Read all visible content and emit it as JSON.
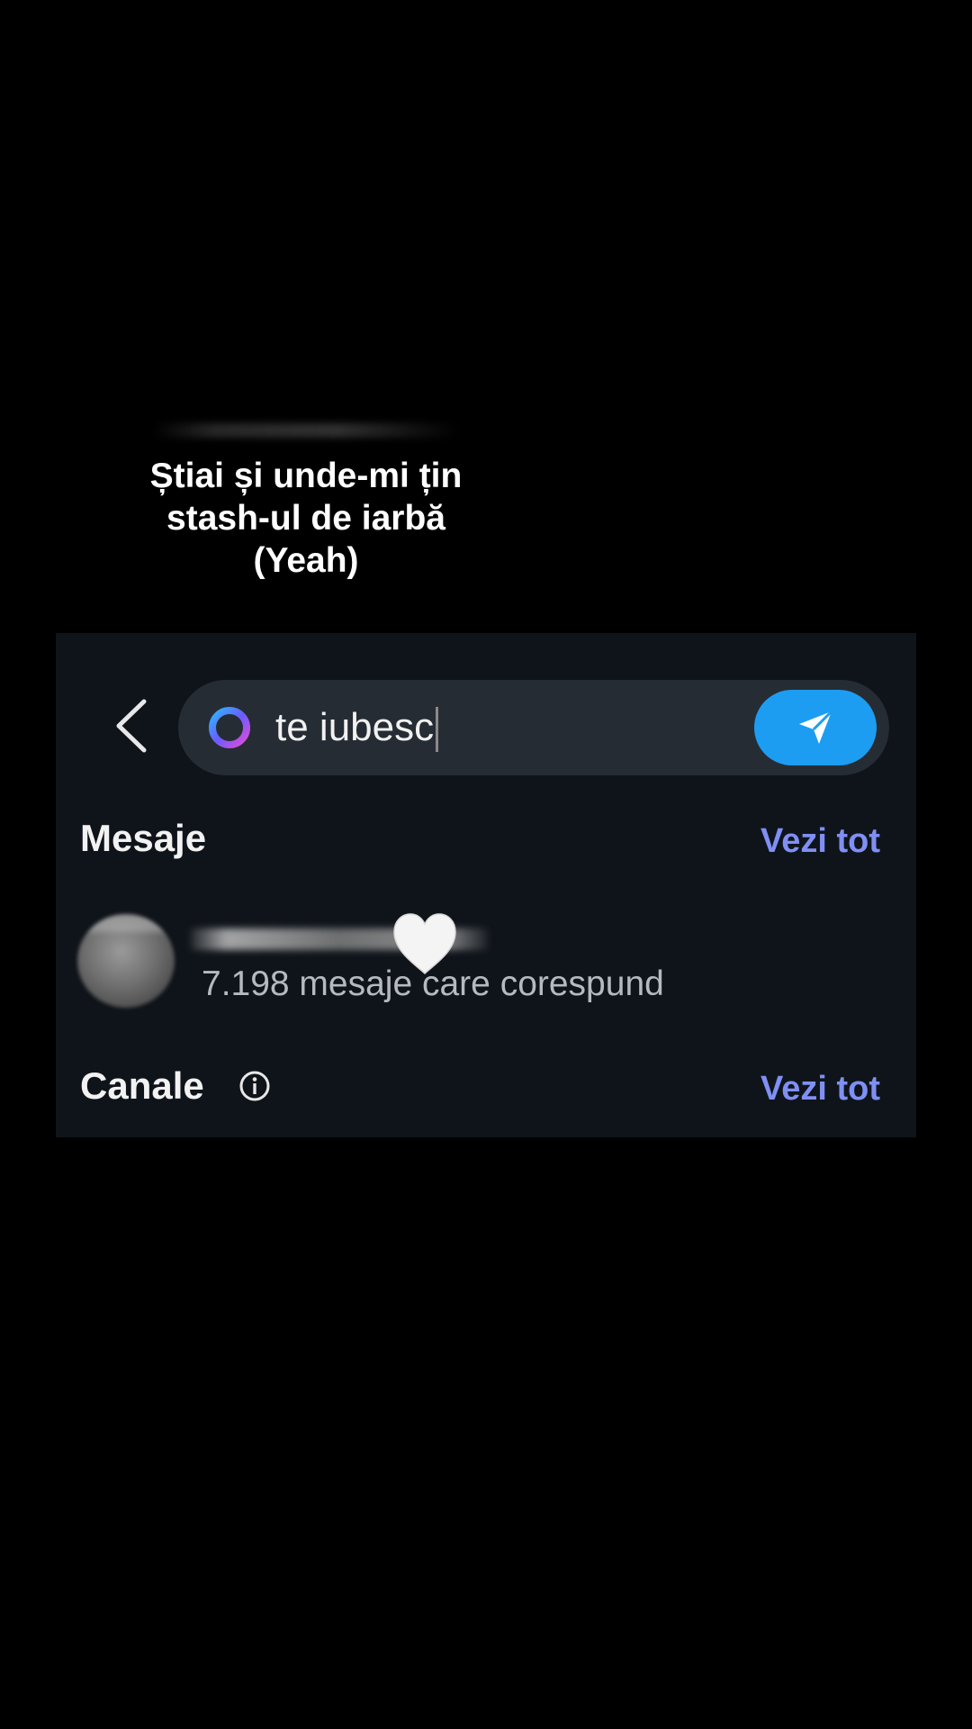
{
  "caption": {
    "lines": [
      "Știai și unde-mi țin",
      "stash-ul de iarbă",
      "(Yeah)"
    ]
  },
  "search": {
    "value": "te iubesc"
  },
  "icons": {
    "back": "chevron-left-icon",
    "search": "gradient-ring-icon",
    "send": "send-arrow-icon",
    "favorite": "white-heart-icon",
    "info": "info-icon"
  },
  "colors": {
    "accent_link": "#7f8ff4",
    "send_button": "#1c9df2",
    "panel_background": "#0f141a",
    "search_background": "#262c33"
  },
  "sections": {
    "messages": {
      "title": "Mesaje",
      "see_all": "Vezi tot",
      "results": [
        {
          "subtitle": "7.198 mesaje care corespund"
        }
      ]
    },
    "channels": {
      "title": "Canale",
      "see_all": "Vezi tot"
    }
  }
}
